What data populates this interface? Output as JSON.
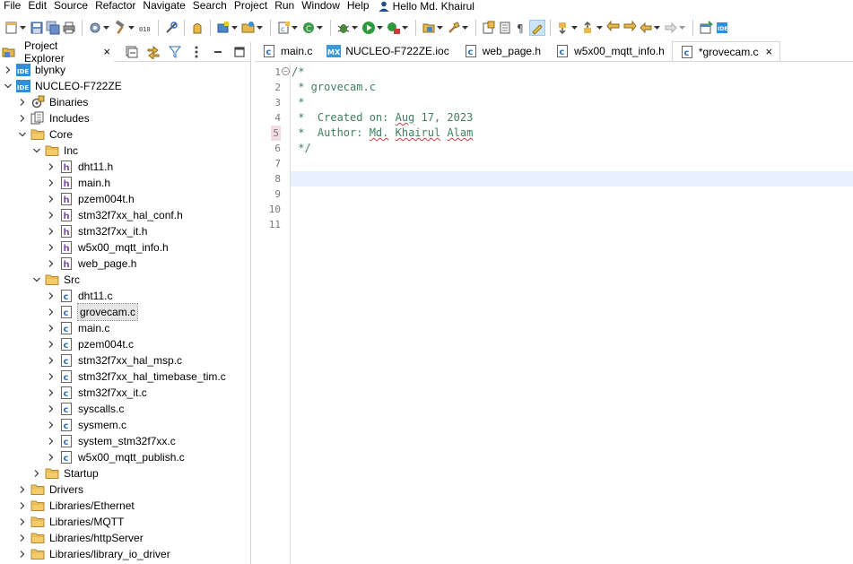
{
  "menu": [
    "File",
    "Edit",
    "Source",
    "Refactor",
    "Navigate",
    "Search",
    "Project",
    "Run",
    "Window",
    "Help"
  ],
  "user": "Hello Md. Khairul",
  "explorer": {
    "tab_label": "Project Explorer",
    "tab_close": "×",
    "tree": [
      {
        "label": "blynky",
        "icon": "ide-project-icon",
        "depth": 0,
        "expanded": false
      },
      {
        "label": "NUCLEO-F722ZE",
        "icon": "ide-project-icon",
        "depth": 0,
        "expanded": true
      },
      {
        "label": "Binaries",
        "icon": "binaries-icon",
        "depth": 1,
        "expanded": false
      },
      {
        "label": "Includes",
        "icon": "includes-icon",
        "depth": 1,
        "expanded": false
      },
      {
        "label": "Core",
        "icon": "folder-icon",
        "depth": 1,
        "expanded": true
      },
      {
        "label": "Inc",
        "icon": "folder-icon",
        "depth": 2,
        "expanded": true
      },
      {
        "label": "dht11.h",
        "icon": "header-file-icon",
        "depth": 3,
        "expanded": false
      },
      {
        "label": "main.h",
        "icon": "header-file-icon",
        "depth": 3,
        "expanded": false
      },
      {
        "label": "pzem004t.h",
        "icon": "header-file-icon",
        "depth": 3,
        "expanded": false
      },
      {
        "label": "stm32f7xx_hal_conf.h",
        "icon": "header-file-icon",
        "depth": 3,
        "expanded": false
      },
      {
        "label": "stm32f7xx_it.h",
        "icon": "header-file-icon",
        "depth": 3,
        "expanded": false
      },
      {
        "label": "w5x00_mqtt_info.h",
        "icon": "header-file-icon",
        "depth": 3,
        "expanded": false
      },
      {
        "label": "web_page.h",
        "icon": "header-file-icon",
        "depth": 3,
        "expanded": false
      },
      {
        "label": "Src",
        "icon": "folder-icon",
        "depth": 2,
        "expanded": true
      },
      {
        "label": "dht11.c",
        "icon": "c-file-icon",
        "depth": 3,
        "expanded": false
      },
      {
        "label": "grovecam.c",
        "icon": "c-file-icon",
        "depth": 3,
        "expanded": false,
        "selected": true
      },
      {
        "label": "main.c",
        "icon": "c-file-icon",
        "depth": 3,
        "expanded": false
      },
      {
        "label": "pzem004t.c",
        "icon": "c-file-icon",
        "depth": 3,
        "expanded": false
      },
      {
        "label": "stm32f7xx_hal_msp.c",
        "icon": "c-file-icon",
        "depth": 3,
        "expanded": false
      },
      {
        "label": "stm32f7xx_hal_timebase_tim.c",
        "icon": "c-file-icon",
        "depth": 3,
        "expanded": false
      },
      {
        "label": "stm32f7xx_it.c",
        "icon": "c-file-icon",
        "depth": 3,
        "expanded": false
      },
      {
        "label": "syscalls.c",
        "icon": "c-file-icon",
        "depth": 3,
        "expanded": false
      },
      {
        "label": "sysmem.c",
        "icon": "c-file-icon",
        "depth": 3,
        "expanded": false
      },
      {
        "label": "system_stm32f7xx.c",
        "icon": "c-file-icon",
        "depth": 3,
        "expanded": false
      },
      {
        "label": "w5x00_mqtt_publish.c",
        "icon": "c-file-icon",
        "depth": 3,
        "expanded": false
      },
      {
        "label": "Startup",
        "icon": "folder-icon",
        "depth": 2,
        "expanded": false
      },
      {
        "label": "Drivers",
        "icon": "folder-icon",
        "depth": 1,
        "expanded": false
      },
      {
        "label": "Libraries/Ethernet",
        "icon": "folder-icon",
        "depth": 1,
        "expanded": false
      },
      {
        "label": "Libraries/MQTT",
        "icon": "folder-icon",
        "depth": 1,
        "expanded": false
      },
      {
        "label": "Libraries/httpServer",
        "icon": "folder-icon",
        "depth": 1,
        "expanded": false
      },
      {
        "label": "Libraries/library_io_driver",
        "icon": "folder-icon",
        "depth": 1,
        "expanded": false
      }
    ]
  },
  "editor": {
    "tabs": [
      {
        "label": "main.c",
        "icon": "c-file-icon",
        "active": false
      },
      {
        "label": "NUCLEO-F722ZE.ioc",
        "icon": "mx-icon",
        "active": false
      },
      {
        "label": "web_page.h",
        "icon": "c-file-icon",
        "active": false
      },
      {
        "label": "w5x00_mqtt_info.h",
        "icon": "c-file-icon",
        "active": false
      },
      {
        "label": "*grovecam.c",
        "icon": "c-file-icon",
        "active": true
      }
    ],
    "tab_close": "×",
    "line_numbers": [
      "1",
      "2",
      "3",
      "4",
      "5",
      "6",
      "7",
      "8",
      "9",
      "10",
      "11"
    ],
    "code_lines": [
      "/*",
      " * grovecam.c",
      " *",
      " *  Created on: Aug 17, 2023",
      " *  Author: Md. Khairul Alam",
      " */",
      "",
      "",
      "",
      "",
      ""
    ],
    "current_line": 8,
    "marked_line": 5
  },
  "colors": {
    "comment": "#3f7f5f",
    "current_line_bg": "#e8f2fe",
    "selection_bg": "#e5e5e5",
    "ide_badge": "#2f8fd8",
    "folder": "#e8b84a"
  }
}
